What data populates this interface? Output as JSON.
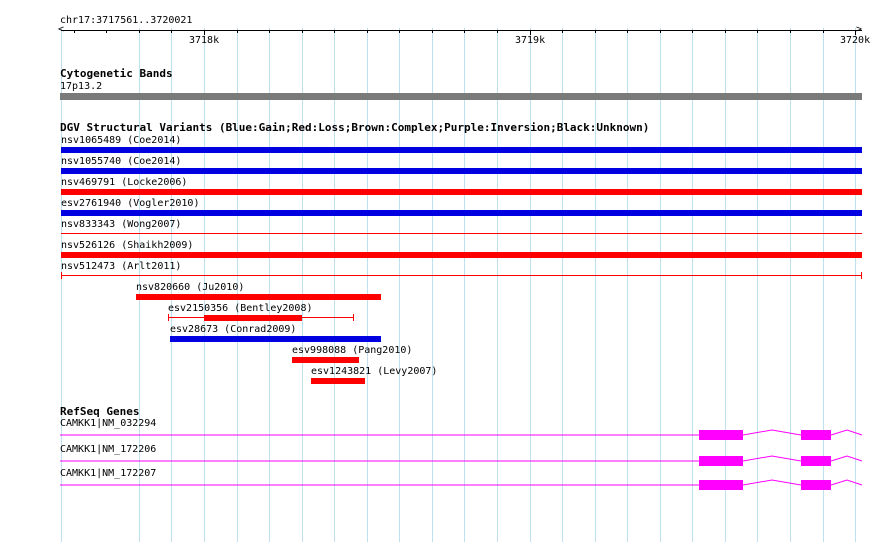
{
  "ruler": {
    "locus": "chr17:3717561..3720021",
    "start": 3717561,
    "end": 3720021,
    "labels": [
      {
        "text": "3718k",
        "pos": 3718000
      },
      {
        "text": "3719k",
        "pos": 3719000
      },
      {
        "text": "3720k",
        "pos": 3720000
      }
    ]
  },
  "cytobands": {
    "title": "Cytogenetic Bands",
    "band": "17p13.2",
    "color": "#7a7a7a"
  },
  "dgv": {
    "title": "DGV Structural Variants (Blue:Gain;Red:Loss;Brown:Complex;Purple:Inversion;Black:Unknown)",
    "colors": {
      "gain": "#0000e0",
      "loss": "#ff0000"
    },
    "features": [
      {
        "label": "nsv1065489 (Coe2014)",
        "type": "gain",
        "start": 3717561,
        "end": 3720021,
        "style": "thick"
      },
      {
        "label": "nsv1055740 (Coe2014)",
        "type": "gain",
        "start": 3717561,
        "end": 3720021,
        "style": "thick"
      },
      {
        "label": "nsv469791 (Locke2006)",
        "type": "loss",
        "start": 3717561,
        "end": 3720021,
        "style": "thick"
      },
      {
        "label": "esv2761940 (Vogler2010)",
        "type": "gain",
        "start": 3717561,
        "end": 3720021,
        "style": "thick"
      },
      {
        "label": "nsv833343 (Wong2007)",
        "type": "loss",
        "start": 3717561,
        "end": 3720021,
        "style": "thin"
      },
      {
        "label": "nsv526126 (Shaikh2009)",
        "type": "loss",
        "start": 3717561,
        "end": 3720021,
        "style": "thick"
      },
      {
        "label": "nsv512473 (Arlt2011)",
        "type": "loss",
        "start": 3717561,
        "end": 3720021,
        "style": "bracket"
      },
      {
        "label": "nsv820660 (Ju2010)",
        "type": "loss",
        "start": 3717790,
        "end": 3718545,
        "style": "thick"
      },
      {
        "label": "esv2150356 (Bentley2008)",
        "type": "loss",
        "start": 3717890,
        "end": 3718460,
        "style": "bracket",
        "thickStart": 3718000,
        "thickEnd": 3718300
      },
      {
        "label": "esv28673 (Conrad2009)",
        "type": "gain",
        "start": 3717895,
        "end": 3718545,
        "style": "thick"
      },
      {
        "label": "esv998088 (Pang2010)",
        "type": "loss",
        "start": 3718270,
        "end": 3718475,
        "style": "thick"
      },
      {
        "label": "esv1243821 (Levy2007)",
        "type": "loss",
        "start": 3718330,
        "end": 3718495,
        "style": "thick"
      }
    ]
  },
  "refseq": {
    "title": "RefSeq Genes",
    "color": "#ff00ff",
    "genes": [
      {
        "label": "CAMKK1|NM_032294",
        "exons": [
          [
            3719520,
            3719655
          ],
          [
            3719835,
            3719925
          ]
        ]
      },
      {
        "label": "CAMKK1|NM_172206",
        "exons": [
          [
            3719520,
            3719655
          ],
          [
            3719835,
            3719925
          ]
        ]
      },
      {
        "label": "CAMKK1|NM_172207",
        "exons": [
          [
            3719520,
            3719655
          ],
          [
            3719835,
            3719925
          ]
        ]
      }
    ]
  },
  "grid_positions": [
    3717561,
    3717800,
    3717900,
    3718000,
    3718100,
    3718200,
    3718300,
    3718400,
    3718500,
    3718600,
    3718700,
    3718800,
    3718900,
    3719000,
    3719100,
    3719200,
    3719300,
    3719400,
    3719500,
    3719600,
    3719700,
    3719800,
    3719900,
    3720000
  ]
}
